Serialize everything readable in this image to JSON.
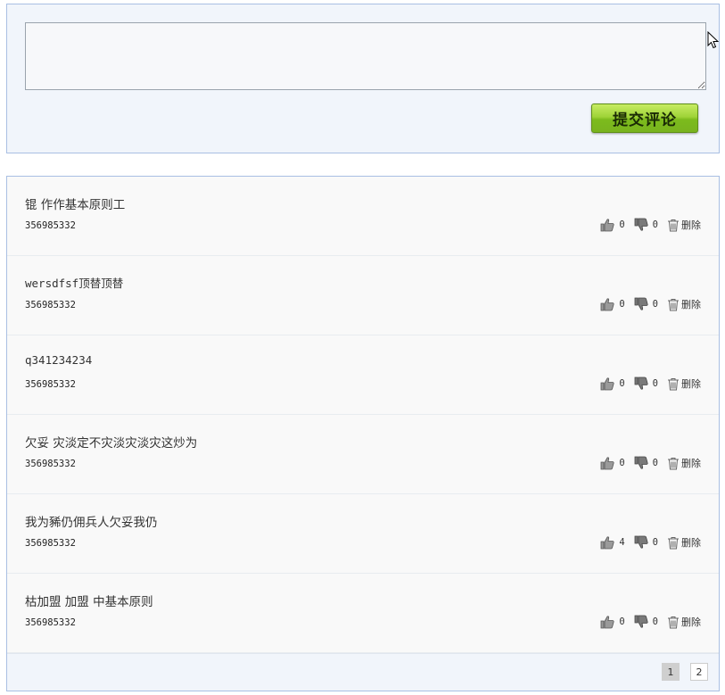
{
  "compose": {
    "textarea_value": "",
    "submit_label": "提交评论"
  },
  "comments": [
    {
      "text": "锟 作作基本原则工",
      "user": "356985332",
      "likes": "0",
      "dislikes": "0",
      "delete_label": "删除"
    },
    {
      "text": "wersdfsf顶替顶替",
      "user": "356985332",
      "likes": "0",
      "dislikes": "0",
      "delete_label": "删除"
    },
    {
      "text": "q341234234",
      "user": "356985332",
      "likes": "0",
      "dislikes": "0",
      "delete_label": "删除"
    },
    {
      "text": "欠妥 灾淡定不灾淡灾淡灾这炒为",
      "user": "356985332",
      "likes": "0",
      "dislikes": "0",
      "delete_label": "删除"
    },
    {
      "text": "我为豨仍佣兵人欠妥我仍",
      "user": "356985332",
      "likes": "4",
      "dislikes": "0",
      "delete_label": "删除"
    },
    {
      "text": "枯加盟 加盟 中基本原则",
      "user": "356985332",
      "likes": "0",
      "dislikes": "0",
      "delete_label": "删除"
    }
  ],
  "pagination": {
    "current": "1",
    "next": "2"
  },
  "colors": {
    "compose_bg": "#f1f5fb",
    "border": "#a9bfe3",
    "button_green": "#8cc72b",
    "list_bg": "#f9f9f9"
  }
}
